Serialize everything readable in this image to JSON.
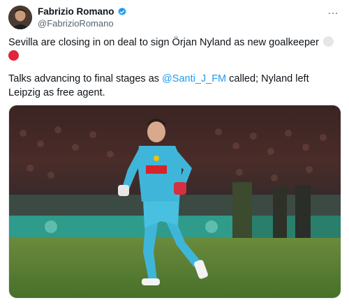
{
  "author": {
    "name": "Fabrizio Romano",
    "handle": "@FabrizioRomano",
    "verified": true
  },
  "more_icon": "…",
  "tweet": {
    "line1": "Sevilla are closing in on deal to sign Örjan Nyland as new goalkeeper",
    "line2_prefix": "Talks advancing to final stages as ",
    "mention": "@Santi_J_FM",
    "line2_suffix": " called; Nyland left Leipzig as free agent."
  },
  "media": {
    "kind": "photo",
    "subject": "goalkeeper in light-blue kit running on pitch"
  },
  "colors": {
    "accent": "#1d9bf0",
    "text": "#0f1419",
    "secondary": "#536471",
    "kit": "#3fb6d9"
  }
}
